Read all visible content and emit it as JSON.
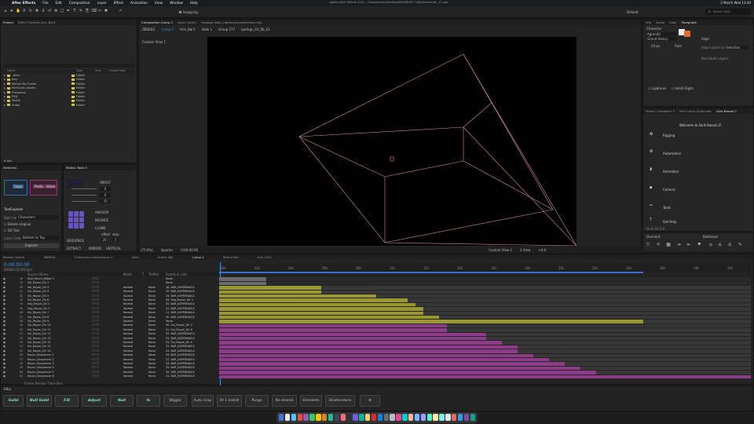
{
  "menubar": {
    "app": "After Effects",
    "items": [
      "File",
      "Edit",
      "Composition",
      "Layer",
      "Effect",
      "Animation",
      "View",
      "Window",
      "Help"
    ],
    "title": "Adobe After Effects 2022 - /Users/anton/Desktop/SHOWUPH 7/AE/Animación_12.aep",
    "right": [
      "Default",
      "Search Help",
      "2 March Wed  13:40"
    ]
  },
  "toolbar": {
    "snapping": "Snapping",
    "workspace": "Default",
    "search": "Search Help"
  },
  "project": {
    "tabs": [
      "Project",
      "Effect Controls Arm_Bar1"
    ],
    "columns": [
      "Name",
      "Type",
      "Size",
      "Frame Rate"
    ],
    "items": [
      {
        "name": "_Alien",
        "type": "Folder"
      },
      {
        "name": "bkg",
        "type": "Folder"
      },
      {
        "name": "Motion Bro Folder",
        "type": "Folder"
      },
      {
        "name": "Particular_Assets",
        "type": "Folder"
      },
      {
        "name": "Precomps",
        "type": "Folder"
      },
      {
        "name": "PSD",
        "type": "Folder"
      },
      {
        "name": "Solids",
        "type": "Folder"
      },
      {
        "name": "Video",
        "type": "Folder"
      }
    ],
    "bpc": "8 bpc"
  },
  "selection": {
    "tab": "Selection",
    "copy_label": "Copy",
    "paste_label": "Paste",
    "reset_label": "Reset",
    "value_label": "Value",
    "text_explode": "TextExplode",
    "split_into": "Split Into",
    "split_value": "Characters",
    "delete_original": "Delete original",
    "3d_text": "3D Text",
    "layer_order": "Layer Order",
    "layer_order_value": "Bottom to Top",
    "explode": "Explode"
  },
  "motion_tools": {
    "tab": "Motion Tools 2",
    "about": "ABOUT",
    "anchor": "ANCHOR",
    "bounce": "BOUNCE",
    "clone": "CLONE",
    "offset": "offset",
    "step": "step",
    "sequence": "SEQUENCE",
    "extract": "EXTRACT",
    "mirror": "MIRROR",
    "vertical": "VERTICAL",
    "values": [
      "0",
      "0",
      "75",
      "20",
      "1"
    ]
  },
  "composition": {
    "tabs": [
      "Composition Comp 2",
      "Layer (none)",
      "Footage Koby_Lighting-Arrestor-Vols.mp4"
    ],
    "breadcrumb": [
      "ZBREED",
      "Comp 2",
      "Arm_Bar1",
      "Slide 1",
      "Group 277",
      "qortkgc_01_0b_01"
    ],
    "view_label": "Custom View 1",
    "footer": {
      "zoom": "(75.9%)",
      "res": "Quarter",
      "time": "0:00:00:00",
      "camera": "Custom View 1",
      "views": "1 View",
      "offset": "+0.0"
    }
  },
  "right_panels": {
    "tabs_top": [
      "Info",
      "Audio",
      "Align",
      "Paragraph"
    ],
    "character_label": "Character",
    "font": "Agrandir",
    "font_style": "Grand Heavy",
    "font_size": "24 px",
    "leading": "Auto",
    "align": "Align",
    "align_to": "Align Layers to",
    "align_to_value": "Selection",
    "distribute": "Distribute Layers:",
    "ligatures": "Ligatures",
    "hindi_digits": "Hindi Digits",
    "script_tabs": [
      "Motion Composer 3",
      "Post Comp Duplicator",
      "Duik Bassel.2"
    ],
    "duik_welcome": "Welcome to Duik Bassel.2!",
    "duik_items": [
      "Rigging",
      "Automation",
      "Animation",
      "Camera",
      "Tools",
      "Get Help"
    ],
    "duik_version": "Duik 16.2.9",
    "overlord": "Overlord",
    "battleaxe": "Battleaxe"
  },
  "timeline": {
    "tabs": [
      "Render Queue",
      "ZBREED",
      "Turbulence shotcleanup 2",
      "Alien",
      "Imesh_Bar",
      "Comp 2",
      "Stomp Fall",
      "Arm_Ext1"
    ],
    "timecode": "0:00:00:00",
    "fps": "00000 (25.00 fps)",
    "columns": [
      "Source Name",
      "Mode",
      "T",
      "TrkMat",
      "Parent & Link"
    ],
    "ruler": [
      "00s",
      "02s",
      "04s",
      "06s",
      "08s",
      "10s",
      "12s",
      "14s",
      "16s",
      "18s",
      "20s",
      "22s",
      "24s",
      "26s",
      "28s",
      "30s"
    ],
    "footer": "Frame Render Time  0ms",
    "layers": [
      {
        "n": "38",
        "name": "Null_Pamm_Nilbar 2",
        "mode": "",
        "trk": "",
        "parent": "None"
      },
      {
        "n": "39",
        "name": "Sol_Rayon_Dir 2",
        "mode": "",
        "trk": "",
        "parent": "None"
      },
      {
        "n": "40",
        "name": "Sol_Rayon_Dir 3",
        "mode": "Normal",
        "trk": "None",
        "parent": "16. BAR_KAPERNAICA"
      },
      {
        "n": "41",
        "name": "Sol_Rayon_Dir 4",
        "mode": "Normal",
        "trk": "None",
        "parent": "19. BAR_KAPERNAICA"
      },
      {
        "n": "42",
        "name": "Sol_Rayon_Dir 5",
        "mode": "Normal",
        "trk": "None",
        "parent": "14. BAR_KAPERNAICA"
      },
      {
        "n": "43",
        "name": "Sol_Rayon_Dir 6",
        "mode": "Normal",
        "trk": "None",
        "parent": "44. Sag_Rayon_Dir 2"
      },
      {
        "n": "44",
        "name": "Sag_Rayon_Dir 2",
        "mode": "Normal",
        "trk": "None",
        "parent": "26. BAR_KAPERNAICA"
      },
      {
        "n": "45",
        "name": "Sag_Rayon_Dir 3",
        "mode": "Normal",
        "trk": "None",
        "parent": "22. BAR_KAPERNAICA"
      },
      {
        "n": "46",
        "name": "Sol_Rayon_Dir 7",
        "mode": "Normal",
        "trk": "None",
        "parent": "21. BAR_KAPERNAICA"
      },
      {
        "n": "47",
        "name": "Sol_Rayon_Dir 8",
        "mode": "Normal",
        "trk": "None",
        "parent": "30. BAR_KAPERNAICA"
      },
      {
        "n": "48",
        "name": "Sol_Rayon_Dir 9",
        "mode": "Normal",
        "trk": "None",
        "parent": "None"
      },
      {
        "n": "49",
        "name": "Sol_Rayon_Dir 10",
        "mode": "Normal",
        "trk": "None",
        "parent": "49. Sol_Rayon_Dir 3"
      },
      {
        "n": "50",
        "name": "Sol_Rayon_Dir 11",
        "mode": "Normal",
        "trk": "None",
        "parent": "51. Sol_Rayon_Dir 8"
      },
      {
        "n": "51",
        "name": "Sol_Rayon_Dir 12",
        "mode": "Normal",
        "trk": "None",
        "parent": "52. BAR_KAPERNAICA"
      },
      {
        "n": "52",
        "name": "Sol_Rayon_Dir 13",
        "mode": "Normal",
        "trk": "None",
        "parent": "23. BAR_KAPERNAICA"
      },
      {
        "n": "53",
        "name": "Sol_Rayon_Dir 14",
        "mode": "Normal",
        "trk": "None",
        "parent": "53. Sol_Rayon_Dir 4"
      },
      {
        "n": "54",
        "name": "Sol_Rayon_Dir 15",
        "mode": "Normal",
        "trk": "None",
        "parent": "25. BAR_KAPERNAICA"
      },
      {
        "n": "55",
        "name": "Sol_Rayon_Dir 16",
        "mode": "Normal",
        "trk": "None",
        "parent": "24. BAR_KAPERNAICA"
      },
      {
        "n": "56",
        "name": "Rayon_Sequencer 1",
        "mode": "Normal",
        "trk": "None",
        "parent": "26. BAR_KAPERNAICA"
      },
      {
        "n": "57",
        "name": "Rayon_Sequencer 2",
        "mode": "Normal",
        "trk": "None",
        "parent": "27. BAR_KAPERNAICA"
      },
      {
        "n": "58",
        "name": "Rayon_Sequencer 3",
        "mode": "Normal",
        "trk": "None",
        "parent": "28. BAR_KAPERNAICA"
      },
      {
        "n": "59",
        "name": "Rayon_Sequencer 4",
        "mode": "Normal",
        "trk": "None",
        "parent": "29. BAR_KAPERNAICA"
      },
      {
        "n": "60",
        "name": "Rayon_Sequencer 5",
        "mode": "Normal",
        "trk": "None",
        "parent": "30. BAR_KAPERNAICA"
      },
      {
        "n": "61",
        "name": "Rayon_Sequencer 6",
        "mode": "Normal",
        "trk": "None",
        "parent": "31. BAR_KAPERNAICA"
      }
    ]
  },
  "bars": {
    "colors": {
      "yellow": "#9a9630",
      "magenta": "#8e3b8a",
      "gray": "#6b6b6b",
      "purple": "#66469a"
    }
  },
  "toolbar_bottom": {
    "label": "KBar",
    "buttons": [
      "Solid",
      "Null Solid",
      "Fill",
      "Adjust",
      "Null",
      "fx",
      "Wiggle",
      "Auto Crop",
      "Fit 1 Install",
      "Purge",
      "Re-shared",
      "Elements",
      "Shutterstock",
      "⚙"
    ]
  },
  "accent": "#2d9cf0"
}
